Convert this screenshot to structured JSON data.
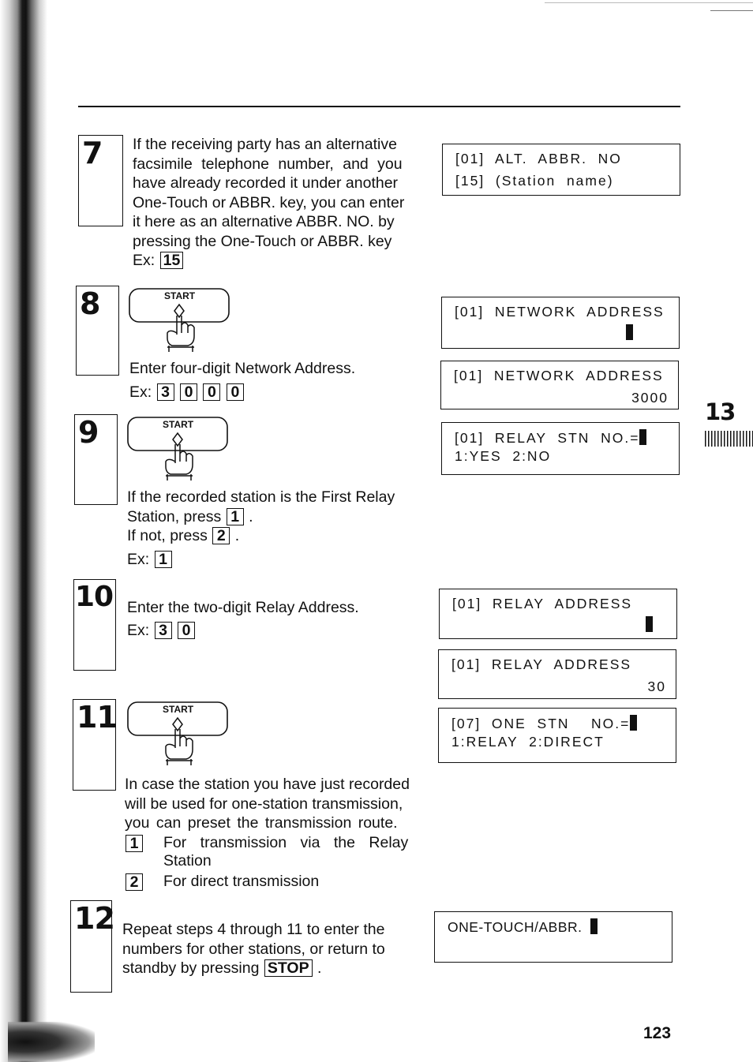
{
  "page": {
    "page_number": "123",
    "chapter_tab": "13"
  },
  "steps": [
    {
      "number": "7",
      "lines": [
        "If the receiving party has an alternative",
        "facsimile telephone number, and you",
        "have already recorded it under another",
        "One-Touch or ABBR. key, you can enter",
        "it here as an alternative ABBR. NO. by",
        "pressing the One-Touch or ABBR. key"
      ],
      "example_label": "Ex:",
      "example_keys": [
        "15"
      ]
    },
    {
      "number": "8",
      "button_label": "START",
      "lines": [
        "Enter four-digit Network Address."
      ],
      "example_label": "Ex:",
      "example_keys": [
        "3",
        "0",
        "0",
        "0"
      ]
    },
    {
      "number": "9",
      "button_label": "START",
      "line1": "If the recorded station is the First Relay",
      "line2_prefix": "Station, press",
      "line2_key": "1",
      "line2_suffix": ".",
      "line3_prefix": "If not, press",
      "line3_key": "2",
      "line3_suffix": ".",
      "example_label": "Ex:",
      "example_keys": [
        "1"
      ]
    },
    {
      "number": "10",
      "lines": [
        "Enter the two-digit Relay Address."
      ],
      "example_label": "Ex:",
      "example_keys": [
        "3",
        "0"
      ]
    },
    {
      "number": "11",
      "button_label": "START",
      "lines": [
        "In case the station you have just recorded",
        "will be used for one-station transmission,",
        "you can preset the transmission route."
      ],
      "options": [
        {
          "key": "1",
          "text_line1": "For transmission via the Relay",
          "text_line2": "Station"
        },
        {
          "key": "2",
          "text_line1": "For direct transmission"
        }
      ]
    },
    {
      "number": "12",
      "lines": [
        "Repeat steps 4 through 11 to enter the",
        "numbers for other stations, or return to"
      ],
      "last_prefix": "standby by pressing",
      "last_key": "STOP",
      "last_suffix": "."
    }
  ],
  "displays": [
    {
      "line1": "[01]  ALT.  ABBR.  NO",
      "line2": "[15]  (Station  name)"
    },
    {
      "line1": "[01]  NETWORK  ADDRESS",
      "cursor": true
    },
    {
      "line1": "[01]  NETWORK  ADDRESS",
      "right_value": "3000"
    },
    {
      "line1": "[01]  RELAY  STN  NO.=",
      "line2": "1:YES  2:NO",
      "inline_cursor": true
    },
    {
      "line1": "[01]  RELAY  ADDRESS",
      "cursor": true
    },
    {
      "line1": "[01]  RELAY  ADDRESS",
      "right_value": "30"
    },
    {
      "line1": "[07]  ONE  STN    NO.=",
      "line2": "1:RELAY  2:DIRECT",
      "inline_cursor": true
    },
    {
      "line1": "ONE-TOUCH/ABBR.",
      "inline_cursor": true
    }
  ]
}
